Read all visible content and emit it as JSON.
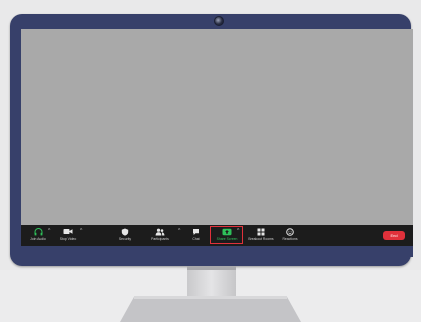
{
  "toolbar": {
    "join_audio": {
      "label": "Join Audio",
      "icon": "headphones-icon"
    },
    "stop_video": {
      "label": "Stop Video",
      "icon": "video-camera-icon"
    },
    "security": {
      "label": "Security",
      "icon": "shield-icon"
    },
    "participants": {
      "label": "Participants",
      "icon": "participants-icon"
    },
    "chat": {
      "label": "Chat",
      "icon": "chat-bubble-icon"
    },
    "share_screen": {
      "label": "Share Screen",
      "icon": "share-screen-icon"
    },
    "breakout_rooms": {
      "label": "Breakout Rooms",
      "icon": "grid-icon"
    },
    "reactions": {
      "label": "Reactions",
      "icon": "smiley-icon"
    },
    "end": {
      "label": "End"
    }
  },
  "colors": {
    "bezel": "#37406a",
    "screen": "#a9a9a9",
    "toolbar": "#1c1c1c",
    "share_accent": "#2ec05a",
    "highlight_border": "#e0313b",
    "end_button": "#e0313b"
  }
}
